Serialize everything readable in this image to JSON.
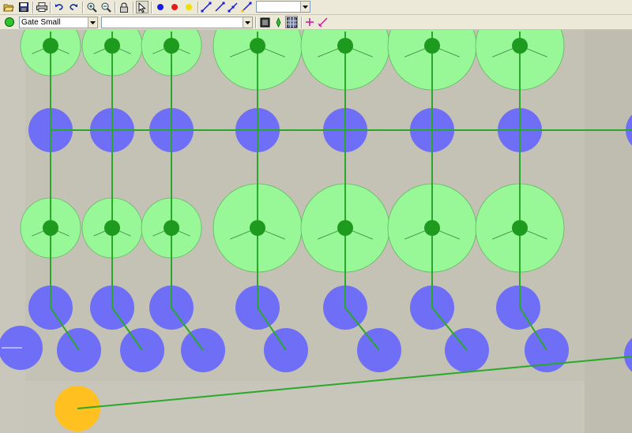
{
  "toolbar": {
    "top_buttons": [
      {
        "name": "open-folder-icon"
      },
      {
        "name": "save-icon"
      },
      {
        "name": "print-icon"
      },
      {
        "name": "undo-icon"
      },
      {
        "name": "redo-icon"
      },
      {
        "name": "zoom-in-icon"
      },
      {
        "name": "zoom-out-icon"
      },
      {
        "name": "lock-icon"
      },
      {
        "name": "select-pointer-icon"
      },
      {
        "name": "blue-dot-icon"
      },
      {
        "name": "red-dot-icon"
      },
      {
        "name": "yellow-dot-icon"
      },
      {
        "name": "line-tool-1-icon"
      },
      {
        "name": "line-tool-2-icon"
      },
      {
        "name": "line-tool-3-icon"
      },
      {
        "name": "line-tool-4-icon"
      }
    ],
    "top_dropdown_value": "",
    "layer_dropdown_value": "Gate Small",
    "second_dropdown_value": "",
    "second_buttons": [
      {
        "name": "fit-view-icon"
      },
      {
        "name": "crosshair-icon"
      },
      {
        "name": "grid-icon"
      },
      {
        "name": "add-point-icon"
      },
      {
        "name": "edit-line-icon"
      }
    ]
  },
  "colors": {
    "canvas_bg": "#c4c2b5",
    "gate_circle": "#98f898",
    "gate_center": "#1e9a1e",
    "node_circle": "#6e6ef6",
    "wire": "#2aa82a",
    "start_node": "#ffc020"
  }
}
